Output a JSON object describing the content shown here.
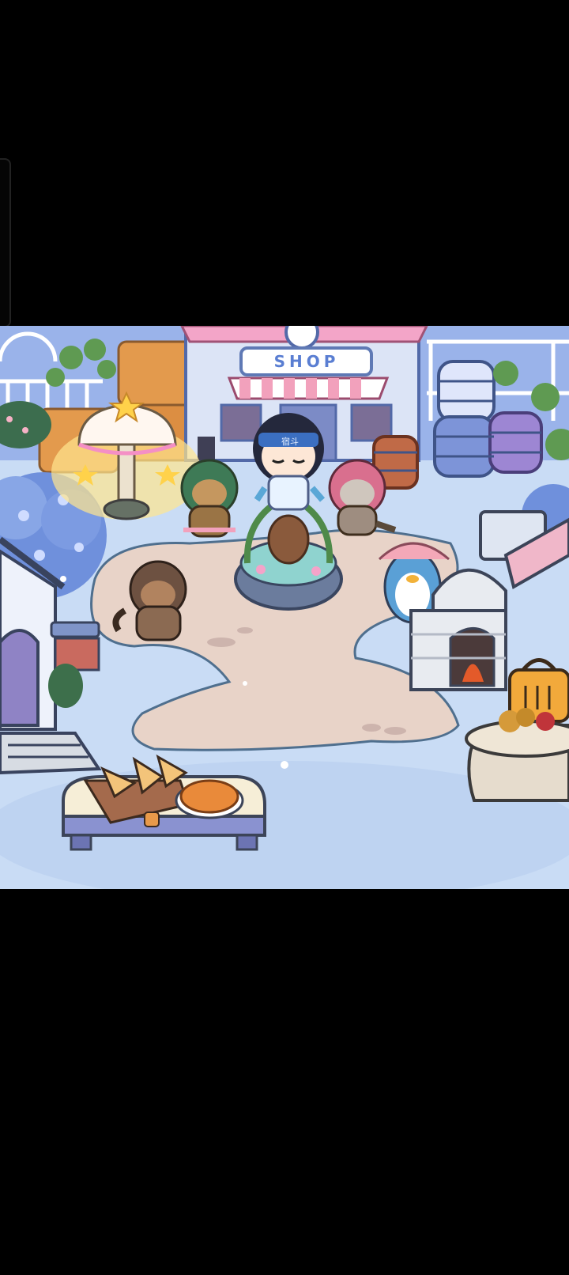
{
  "scene": {
    "shop_sign": "SHOP",
    "headband_text": "宿斗"
  },
  "icons": [
    "flower-tree-icon",
    "mushroom-lamp-icon",
    "hay-bale-icon",
    "shop-building-icon",
    "barrel-icon",
    "cottage-icon",
    "fountain-icon",
    "brick-oven-icon",
    "basket-icon",
    "bread-table-icon",
    "tree-stump-icon"
  ],
  "colors": {
    "ground": "#c9dcf5",
    "path": "#e8d3c8",
    "shop_awning_pink": "#f2a1bc",
    "shop_wall": "#dce4f6",
    "barrel_blue": "#7d94d8",
    "barrel_purple": "#9d86d3"
  }
}
